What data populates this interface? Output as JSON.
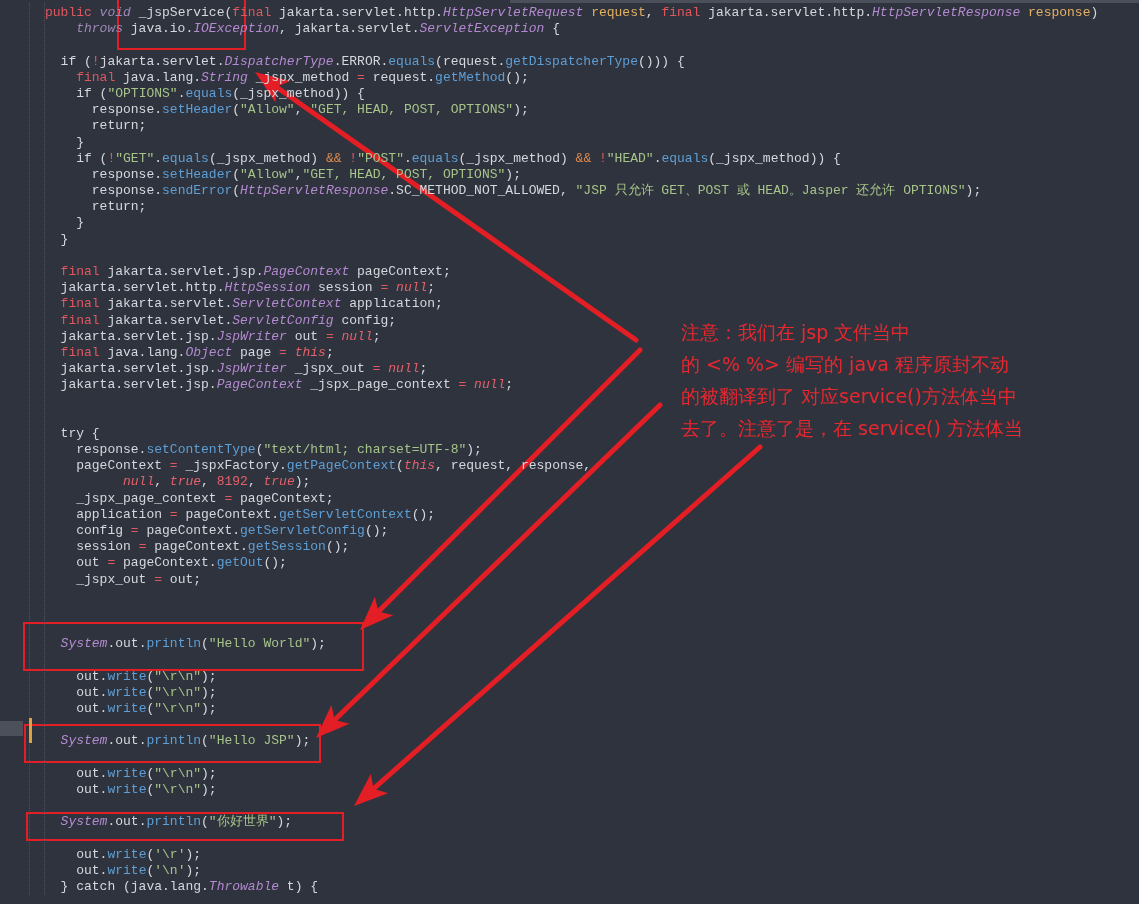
{
  "editor": {
    "lines": [
      {
        "kind": "code",
        "tokens": [
          {
            "text": "public",
            "kind": "kw"
          },
          {
            "text": " void",
            "kind": "mod"
          },
          {
            "text": " _jspService(",
            "kind": "p"
          },
          {
            "text": "final",
            "kind": "kw"
          },
          {
            "text": " jakarta.servlet.http.",
            "kind": "p"
          },
          {
            "text": "HttpServletRequest",
            "kind": "typ"
          },
          {
            "text": " request",
            "kind": "prm"
          },
          {
            "text": ", ",
            "kind": "p"
          },
          {
            "text": "final",
            "kind": "kw"
          },
          {
            "text": " jakarta.servlet.http.",
            "kind": "p"
          },
          {
            "text": "HttpServletResponse",
            "kind": "typ"
          },
          {
            "text": " response",
            "kind": "prm"
          },
          {
            "text": ")",
            "kind": "p"
          }
        ]
      },
      {
        "kind": "code",
        "tokens": [
          {
            "text": "    throws",
            "kind": "mod"
          },
          {
            "text": " java.io.",
            "kind": "p"
          },
          {
            "text": "IOException",
            "kind": "typ"
          },
          {
            "text": ", jakarta.servlet.",
            "kind": "p"
          },
          {
            "text": "ServletException",
            "kind": "typ"
          },
          {
            "text": " {",
            "kind": "p"
          }
        ]
      },
      {
        "kind": "blank"
      },
      {
        "kind": "code",
        "tokens": [
          {
            "text": "  if (",
            "kind": "p"
          },
          {
            "text": "!",
            "kind": "op"
          },
          {
            "text": "jakarta.servlet.",
            "kind": "p"
          },
          {
            "text": "DispatcherType",
            "kind": "typ"
          },
          {
            "text": ".ERROR.",
            "kind": "p"
          },
          {
            "text": "equals",
            "kind": "fn"
          },
          {
            "text": "(request.",
            "kind": "p"
          },
          {
            "text": "getDispatcherType",
            "kind": "fn"
          },
          {
            "text": "())) {",
            "kind": "p"
          }
        ]
      },
      {
        "kind": "code",
        "tokens": [
          {
            "text": "    final",
            "kind": "kw"
          },
          {
            "text": " java.lang.",
            "kind": "p"
          },
          {
            "text": "String",
            "kind": "typ"
          },
          {
            "text": " _jspx_method ",
            "kind": "p"
          },
          {
            "text": "=",
            "kind": "op"
          },
          {
            "text": " request.",
            "kind": "p"
          },
          {
            "text": "getMethod",
            "kind": "fn"
          },
          {
            "text": "();",
            "kind": "p"
          }
        ]
      },
      {
        "kind": "code",
        "tokens": [
          {
            "text": "    if (",
            "kind": "p"
          },
          {
            "text": "\"OPTIONS\"",
            "kind": "str"
          },
          {
            "text": ".",
            "kind": "p"
          },
          {
            "text": "equals",
            "kind": "fn"
          },
          {
            "text": "(_jspx_method)) {",
            "kind": "p"
          }
        ]
      },
      {
        "kind": "code",
        "tokens": [
          {
            "text": "      response.",
            "kind": "p"
          },
          {
            "text": "setHeader",
            "kind": "fn"
          },
          {
            "text": "(",
            "kind": "p"
          },
          {
            "text": "\"Allow\"",
            "kind": "str"
          },
          {
            "text": ", ",
            "kind": "p"
          },
          {
            "text": "\"GET, HEAD, POST, OPTIONS\"",
            "kind": "str"
          },
          {
            "text": ");",
            "kind": "p"
          }
        ]
      },
      {
        "kind": "code",
        "tokens": [
          {
            "text": "      return;",
            "kind": "p"
          }
        ]
      },
      {
        "kind": "code",
        "tokens": [
          {
            "text": "    }",
            "kind": "p"
          }
        ]
      },
      {
        "kind": "code",
        "tokens": [
          {
            "text": "    if (",
            "kind": "p"
          },
          {
            "text": "!",
            "kind": "op"
          },
          {
            "text": "\"GET\"",
            "kind": "str"
          },
          {
            "text": ".",
            "kind": "p"
          },
          {
            "text": "equals",
            "kind": "fn"
          },
          {
            "text": "(_jspx_method) ",
            "kind": "p"
          },
          {
            "text": "&&",
            "kind": "amp"
          },
          {
            "text": " !",
            "kind": "op"
          },
          {
            "text": "\"POST\"",
            "kind": "str"
          },
          {
            "text": ".",
            "kind": "p"
          },
          {
            "text": "equals",
            "kind": "fn"
          },
          {
            "text": "(_jspx_method) ",
            "kind": "p"
          },
          {
            "text": "&&",
            "kind": "amp"
          },
          {
            "text": " !",
            "kind": "op"
          },
          {
            "text": "\"HEAD\"",
            "kind": "str"
          },
          {
            "text": ".",
            "kind": "p"
          },
          {
            "text": "equals",
            "kind": "fn"
          },
          {
            "text": "(_jspx_method)) {",
            "kind": "p"
          }
        ]
      },
      {
        "kind": "code",
        "tokens": [
          {
            "text": "      response.",
            "kind": "p"
          },
          {
            "text": "setHeader",
            "kind": "fn"
          },
          {
            "text": "(",
            "kind": "p"
          },
          {
            "text": "\"Allow\"",
            "kind": "str"
          },
          {
            "text": ",",
            "kind": "p"
          },
          {
            "text": "\"GET, HEAD, POST, OPTIONS\"",
            "kind": "str"
          },
          {
            "text": ");",
            "kind": "p"
          }
        ]
      },
      {
        "kind": "code",
        "tokens": [
          {
            "text": "      response.",
            "kind": "p"
          },
          {
            "text": "sendError",
            "kind": "fn"
          },
          {
            "text": "(",
            "kind": "p"
          },
          {
            "text": "HttpServletResponse",
            "kind": "typ"
          },
          {
            "text": ".SC_METHOD_NOT_ALLOWED, ",
            "kind": "p"
          },
          {
            "text": "\"JSP 只允许 GET、POST 或 HEAD。Jasper 还允许 OPTIONS\"",
            "kind": "str"
          },
          {
            "text": ");",
            "kind": "p"
          }
        ]
      },
      {
        "kind": "code",
        "tokens": [
          {
            "text": "      return;",
            "kind": "p"
          }
        ]
      },
      {
        "kind": "code",
        "tokens": [
          {
            "text": "    }",
            "kind": "p"
          }
        ]
      },
      {
        "kind": "code",
        "tokens": [
          {
            "text": "  }",
            "kind": "p"
          }
        ]
      },
      {
        "kind": "blank"
      },
      {
        "kind": "code",
        "tokens": [
          {
            "text": "  final",
            "kind": "kw"
          },
          {
            "text": " jakarta.servlet.jsp.",
            "kind": "p"
          },
          {
            "text": "PageContext",
            "kind": "typ"
          },
          {
            "text": " pageContext;",
            "kind": "p"
          }
        ]
      },
      {
        "kind": "code",
        "tokens": [
          {
            "text": "  jakarta.servlet.http.",
            "kind": "p"
          },
          {
            "text": "HttpSession",
            "kind": "typ"
          },
          {
            "text": " session ",
            "kind": "p"
          },
          {
            "text": "=",
            "kind": "op"
          },
          {
            "text": " null",
            "kind": "lit"
          },
          {
            "text": ";",
            "kind": "p"
          }
        ]
      },
      {
        "kind": "code",
        "tokens": [
          {
            "text": "  final",
            "kind": "kw"
          },
          {
            "text": " jakarta.servlet.",
            "kind": "p"
          },
          {
            "text": "ServletContext",
            "kind": "typ"
          },
          {
            "text": " application;",
            "kind": "p"
          }
        ]
      },
      {
        "kind": "code",
        "tokens": [
          {
            "text": "  final",
            "kind": "kw"
          },
          {
            "text": " jakarta.servlet.",
            "kind": "p"
          },
          {
            "text": "ServletConfig",
            "kind": "typ"
          },
          {
            "text": " config;",
            "kind": "p"
          }
        ]
      },
      {
        "kind": "code",
        "tokens": [
          {
            "text": "  jakarta.servlet.jsp.",
            "kind": "p"
          },
          {
            "text": "JspWriter",
            "kind": "typ"
          },
          {
            "text": " out ",
            "kind": "p"
          },
          {
            "text": "=",
            "kind": "op"
          },
          {
            "text": " null",
            "kind": "lit"
          },
          {
            "text": ";",
            "kind": "p"
          }
        ]
      },
      {
        "kind": "code",
        "tokens": [
          {
            "text": "  final",
            "kind": "kw"
          },
          {
            "text": " java.lang.",
            "kind": "p"
          },
          {
            "text": "Object",
            "kind": "typ"
          },
          {
            "text": " page ",
            "kind": "p"
          },
          {
            "text": "=",
            "kind": "op"
          },
          {
            "text": " this",
            "kind": "lit"
          },
          {
            "text": ";",
            "kind": "p"
          }
        ]
      },
      {
        "kind": "code",
        "tokens": [
          {
            "text": "  jakarta.servlet.jsp.",
            "kind": "p"
          },
          {
            "text": "JspWriter",
            "kind": "typ"
          },
          {
            "text": " _jspx_out ",
            "kind": "p"
          },
          {
            "text": "=",
            "kind": "op"
          },
          {
            "text": " null",
            "kind": "lit"
          },
          {
            "text": ";",
            "kind": "p"
          }
        ]
      },
      {
        "kind": "code",
        "tokens": [
          {
            "text": "  jakarta.servlet.jsp.",
            "kind": "p"
          },
          {
            "text": "PageContext",
            "kind": "typ"
          },
          {
            "text": " _jspx_page_context ",
            "kind": "p"
          },
          {
            "text": "=",
            "kind": "op"
          },
          {
            "text": " null",
            "kind": "lit"
          },
          {
            "text": ";",
            "kind": "p"
          }
        ]
      },
      {
        "kind": "blank"
      },
      {
        "kind": "blank"
      },
      {
        "kind": "code",
        "tokens": [
          {
            "text": "  try {",
            "kind": "p"
          }
        ]
      },
      {
        "kind": "code",
        "tokens": [
          {
            "text": "    response.",
            "kind": "p"
          },
          {
            "text": "setContentType",
            "kind": "fn"
          },
          {
            "text": "(",
            "kind": "p"
          },
          {
            "text": "\"text/html; charset=UTF-8\"",
            "kind": "str"
          },
          {
            "text": ");",
            "kind": "p"
          }
        ]
      },
      {
        "kind": "code",
        "tokens": [
          {
            "text": "    pageContext ",
            "kind": "p"
          },
          {
            "text": "=",
            "kind": "op"
          },
          {
            "text": " _jspxFactory.",
            "kind": "p"
          },
          {
            "text": "getPageContext",
            "kind": "fn"
          },
          {
            "text": "(",
            "kind": "p"
          },
          {
            "text": "this",
            "kind": "lit"
          },
          {
            "text": ", request, response,",
            "kind": "p"
          }
        ]
      },
      {
        "kind": "code",
        "tokens": [
          {
            "text": "          null",
            "kind": "lit"
          },
          {
            "text": ", ",
            "kind": "p"
          },
          {
            "text": "true",
            "kind": "lit"
          },
          {
            "text": ", ",
            "kind": "p"
          },
          {
            "text": "8192",
            "kind": "num"
          },
          {
            "text": ", ",
            "kind": "p"
          },
          {
            "text": "true",
            "kind": "lit"
          },
          {
            "text": ");",
            "kind": "p"
          }
        ]
      },
      {
        "kind": "code",
        "tokens": [
          {
            "text": "    _jspx_page_context ",
            "kind": "p"
          },
          {
            "text": "=",
            "kind": "op"
          },
          {
            "text": " pageContext;",
            "kind": "p"
          }
        ]
      },
      {
        "kind": "code",
        "tokens": [
          {
            "text": "    application ",
            "kind": "p"
          },
          {
            "text": "=",
            "kind": "op"
          },
          {
            "text": " pageContext.",
            "kind": "p"
          },
          {
            "text": "getServletContext",
            "kind": "fn"
          },
          {
            "text": "();",
            "kind": "p"
          }
        ]
      },
      {
        "kind": "code",
        "tokens": [
          {
            "text": "    config ",
            "kind": "p"
          },
          {
            "text": "=",
            "kind": "op"
          },
          {
            "text": " pageContext.",
            "kind": "p"
          },
          {
            "text": "getServletConfig",
            "kind": "fn"
          },
          {
            "text": "();",
            "kind": "p"
          }
        ]
      },
      {
        "kind": "code",
        "tokens": [
          {
            "text": "    session ",
            "kind": "p"
          },
          {
            "text": "=",
            "kind": "op"
          },
          {
            "text": " pageContext.",
            "kind": "p"
          },
          {
            "text": "getSession",
            "kind": "fn"
          },
          {
            "text": "();",
            "kind": "p"
          }
        ]
      },
      {
        "kind": "code",
        "tokens": [
          {
            "text": "    out ",
            "kind": "p"
          },
          {
            "text": "=",
            "kind": "op"
          },
          {
            "text": " pageContext.",
            "kind": "p"
          },
          {
            "text": "getOut",
            "kind": "fn"
          },
          {
            "text": "();",
            "kind": "p"
          }
        ]
      },
      {
        "kind": "code",
        "tokens": [
          {
            "text": "    _jspx_out ",
            "kind": "p"
          },
          {
            "text": "=",
            "kind": "op"
          },
          {
            "text": " out;",
            "kind": "p"
          }
        ]
      },
      {
        "kind": "blank"
      },
      {
        "kind": "blank"
      },
      {
        "kind": "blank"
      },
      {
        "kind": "code",
        "tokens": [
          {
            "text": "  System",
            "kind": "typ"
          },
          {
            "text": ".out.",
            "kind": "p"
          },
          {
            "text": "println",
            "kind": "fn"
          },
          {
            "text": "(",
            "kind": "p"
          },
          {
            "text": "\"Hello World\"",
            "kind": "str"
          },
          {
            "text": ");",
            "kind": "p"
          }
        ]
      },
      {
        "kind": "blank"
      },
      {
        "kind": "code",
        "tokens": [
          {
            "text": "    out.",
            "kind": "p"
          },
          {
            "text": "write",
            "kind": "fn"
          },
          {
            "text": "(",
            "kind": "p"
          },
          {
            "text": "\"\\r\\n\"",
            "kind": "str"
          },
          {
            "text": ");",
            "kind": "p"
          }
        ]
      },
      {
        "kind": "code",
        "tokens": [
          {
            "text": "    out.",
            "kind": "p"
          },
          {
            "text": "write",
            "kind": "fn"
          },
          {
            "text": "(",
            "kind": "p"
          },
          {
            "text": "\"\\r\\n\"",
            "kind": "str"
          },
          {
            "text": ");",
            "kind": "p"
          }
        ]
      },
      {
        "kind": "code",
        "tokens": [
          {
            "text": "    out.",
            "kind": "p"
          },
          {
            "text": "write",
            "kind": "fn"
          },
          {
            "text": "(",
            "kind": "p"
          },
          {
            "text": "\"\\r\\n\"",
            "kind": "str"
          },
          {
            "text": ");",
            "kind": "p"
          }
        ]
      },
      {
        "kind": "blank"
      },
      {
        "kind": "code",
        "tokens": [
          {
            "text": "  System",
            "kind": "typ"
          },
          {
            "text": ".out.",
            "kind": "p"
          },
          {
            "text": "println",
            "kind": "fn"
          },
          {
            "text": "(",
            "kind": "p"
          },
          {
            "text": "\"Hello JSP\"",
            "kind": "str"
          },
          {
            "text": ");",
            "kind": "p"
          }
        ]
      },
      {
        "kind": "blank"
      },
      {
        "kind": "code",
        "tokens": [
          {
            "text": "    out.",
            "kind": "p"
          },
          {
            "text": "write",
            "kind": "fn"
          },
          {
            "text": "(",
            "kind": "p"
          },
          {
            "text": "\"\\r\\n\"",
            "kind": "str"
          },
          {
            "text": ");",
            "kind": "p"
          }
        ]
      },
      {
        "kind": "code",
        "tokens": [
          {
            "text": "    out.",
            "kind": "p"
          },
          {
            "text": "write",
            "kind": "fn"
          },
          {
            "text": "(",
            "kind": "p"
          },
          {
            "text": "\"\\r\\n\"",
            "kind": "str"
          },
          {
            "text": ");",
            "kind": "p"
          }
        ]
      },
      {
        "kind": "blank"
      },
      {
        "kind": "code",
        "tokens": [
          {
            "text": "  System",
            "kind": "typ"
          },
          {
            "text": ".out.",
            "kind": "p"
          },
          {
            "text": "println",
            "kind": "fn"
          },
          {
            "text": "(",
            "kind": "p"
          },
          {
            "text": "\"你好世界\"",
            "kind": "str"
          },
          {
            "text": ");",
            "kind": "p"
          }
        ]
      },
      {
        "kind": "blank"
      },
      {
        "kind": "code",
        "tokens": [
          {
            "text": "    out.",
            "kind": "p"
          },
          {
            "text": "write",
            "kind": "fn"
          },
          {
            "text": "(",
            "kind": "p"
          },
          {
            "text": "'\\r'",
            "kind": "str"
          },
          {
            "text": ");",
            "kind": "p"
          }
        ]
      },
      {
        "kind": "code",
        "tokens": [
          {
            "text": "    out.",
            "kind": "p"
          },
          {
            "text": "write",
            "kind": "fn"
          },
          {
            "text": "(",
            "kind": "p"
          },
          {
            "text": "'\\n'",
            "kind": "str"
          },
          {
            "text": ");",
            "kind": "p"
          }
        ]
      },
      {
        "kind": "code",
        "tokens": [
          {
            "text": "  } catch (java.lang.",
            "kind": "p"
          },
          {
            "text": "Throwable",
            "kind": "typ"
          },
          {
            "text": " t) {",
            "kind": "p"
          }
        ]
      }
    ]
  },
  "annotation": {
    "lines": [
      "注意：我们在 jsp 文件当中",
      "的 <% %> 编写的 java 程序原封不动",
      "的被翻译到了 对应service()方法体当中",
      "去了。注意了是，在 service() 方法体当"
    ]
  }
}
